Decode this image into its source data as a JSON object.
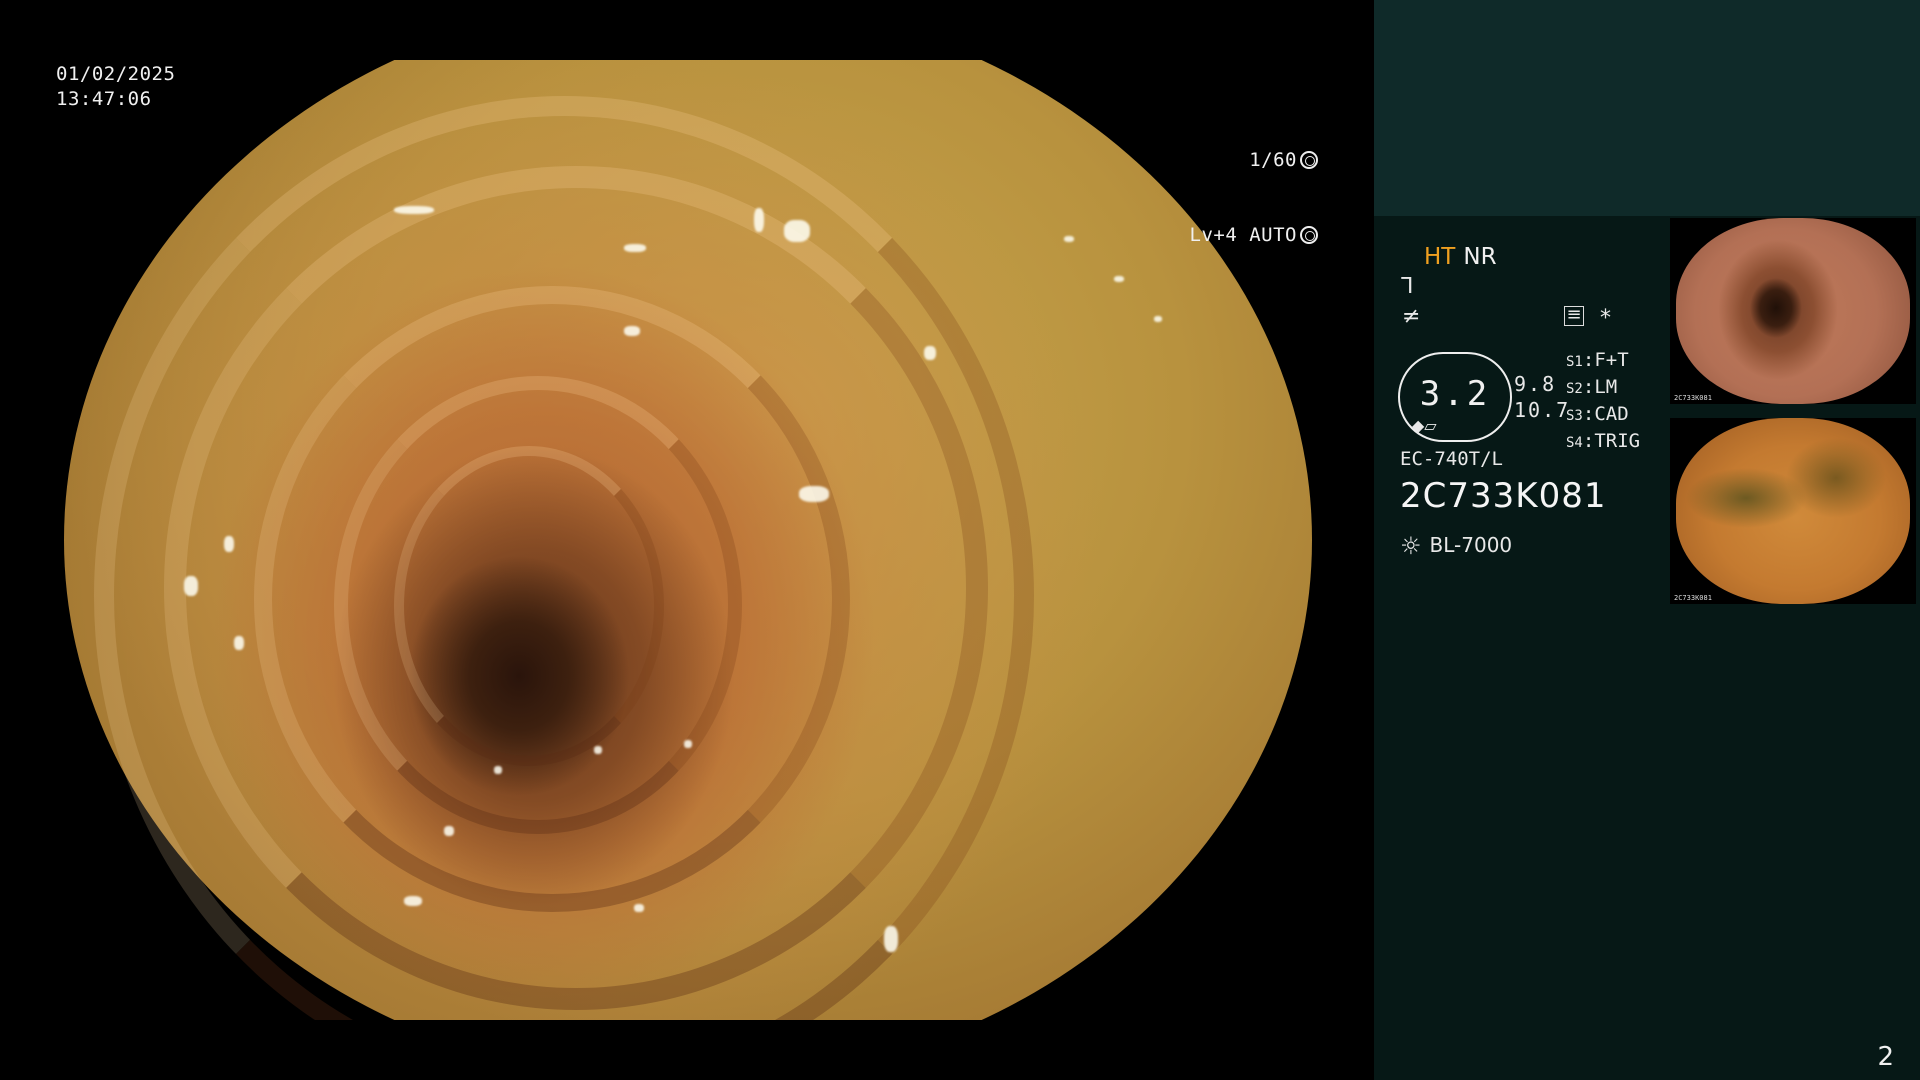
{
  "overlay": {
    "date": "01/02/2025",
    "time": "13:47:06",
    "shutter": "1/60",
    "level": "Lv+4",
    "exposure": "AUTO"
  },
  "panel": {
    "mode_ht": "HT",
    "mode_nr": "NR",
    "zoom_value": "3.2",
    "value_a": "9.8",
    "value_b": "10.7",
    "switches": [
      {
        "key": "S1",
        "value": "F+T"
      },
      {
        "key": "S2",
        "value": "LM"
      },
      {
        "key": "S3",
        "value": "CAD"
      },
      {
        "key": "S4",
        "value": "TRIG"
      }
    ],
    "scope_model": "EC-740T/L",
    "serial": "2C733K081",
    "light_source": "BL-7000",
    "thumb1_label": "2C733K081",
    "thumb2_label": "2C733K081",
    "page_number": "2"
  },
  "colors": {
    "panel_top": "#0f2a29",
    "panel_bottom": "#061816",
    "ht_accent": "#f0a020"
  },
  "icons": [
    "shutter-icon",
    "auto-iris-icon",
    "structure-enhance-icon",
    "color-enhance-icon",
    "record-icon",
    "asterisk-icon",
    "light-source-icon"
  ]
}
